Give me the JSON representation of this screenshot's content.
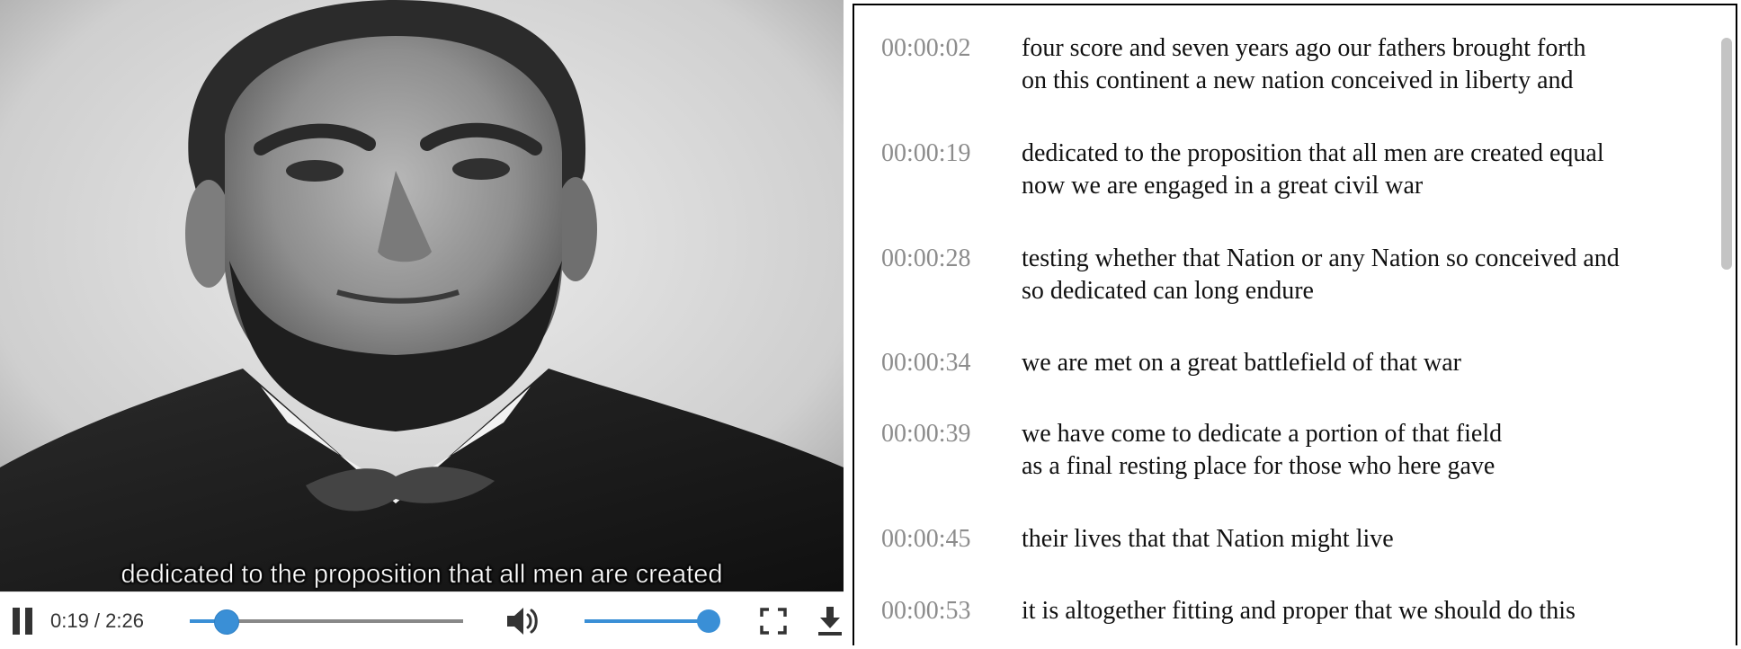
{
  "player": {
    "portrait_description_icon": "portrait-image",
    "caption": "dedicated to the proposition that all men are created",
    "time_display": "0:19 / 2:26",
    "progress_fraction": 0.13,
    "volume_fraction": 0.97,
    "icons": {
      "play_pause": "pause-icon",
      "volume": "volume-icon",
      "fullscreen": "fullscreen-icon",
      "download": "download-icon"
    },
    "accent_color": "#3a8fd6"
  },
  "transcript": {
    "items": [
      {
        "time": "00:00:02",
        "lines": [
          "four score and seven years ago our fathers brought forth",
          "on this continent a new nation conceived in liberty and"
        ]
      },
      {
        "time": "00:00:19",
        "lines": [
          "dedicated to the proposition that all men are created equal",
          "now we are engaged in a great civil war"
        ]
      },
      {
        "time": "00:00:28",
        "lines": [
          "testing whether that Nation or any Nation so conceived and",
          "so dedicated can long endure"
        ]
      },
      {
        "time": "00:00:34",
        "lines": [
          "we are met on a great battlefield of that war"
        ]
      },
      {
        "time": "00:00:39",
        "lines": [
          "we have come to dedicate a portion of that field",
          "as a final resting place for those who here gave"
        ]
      },
      {
        "time": "00:00:45",
        "lines": [
          "their lives that that Nation might live"
        ]
      },
      {
        "time": "00:00:53",
        "lines": [
          "it is altogether fitting and proper that we should do this"
        ]
      }
    ]
  }
}
